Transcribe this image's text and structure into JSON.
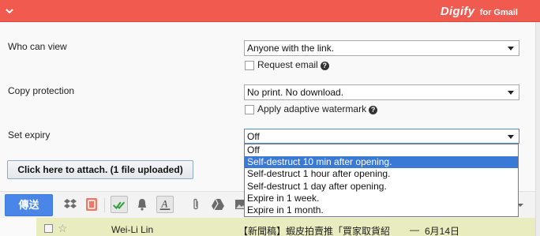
{
  "header": {
    "brand": "Digify",
    "brand_suffix": "for Gmail",
    "accent": "#f05a4f"
  },
  "settings": {
    "who_can_view": {
      "label": "Who can view",
      "value": "Anyone with the link.",
      "checkbox_label": "Request email"
    },
    "copy_protection": {
      "label": "Copy protection",
      "value": "No print. No download.",
      "checkbox_label": "Apply adaptive watermark"
    },
    "set_expiry": {
      "label": "Set expiry",
      "value": "Off",
      "options": [
        "Off",
        "Self-destruct 10 min after opening.",
        "Self-destruct 1 hour after opening.",
        "Self-destruct 1 day after opening.",
        "Expire in 1 week.",
        "Expire in 1 month."
      ],
      "highlighted_option": "Self-destruct 10 min after opening."
    },
    "attach_button": "Click here to attach. (1 file uploaded)"
  },
  "toolbar": {
    "send_label": "傳送",
    "icons": [
      "dropbox-icon",
      "attachment-badge-icon",
      "double-check-icon",
      "bell-icon",
      "text-format-icon",
      "paperclip-icon",
      "drive-icon",
      "photo-icon"
    ]
  },
  "inbox_row": {
    "sender": "Wei-Li Lin",
    "subject": "【新聞稿】蝦皮拍賣推「買家取貨紹",
    "separator": "—",
    "date": "6月14日"
  }
}
